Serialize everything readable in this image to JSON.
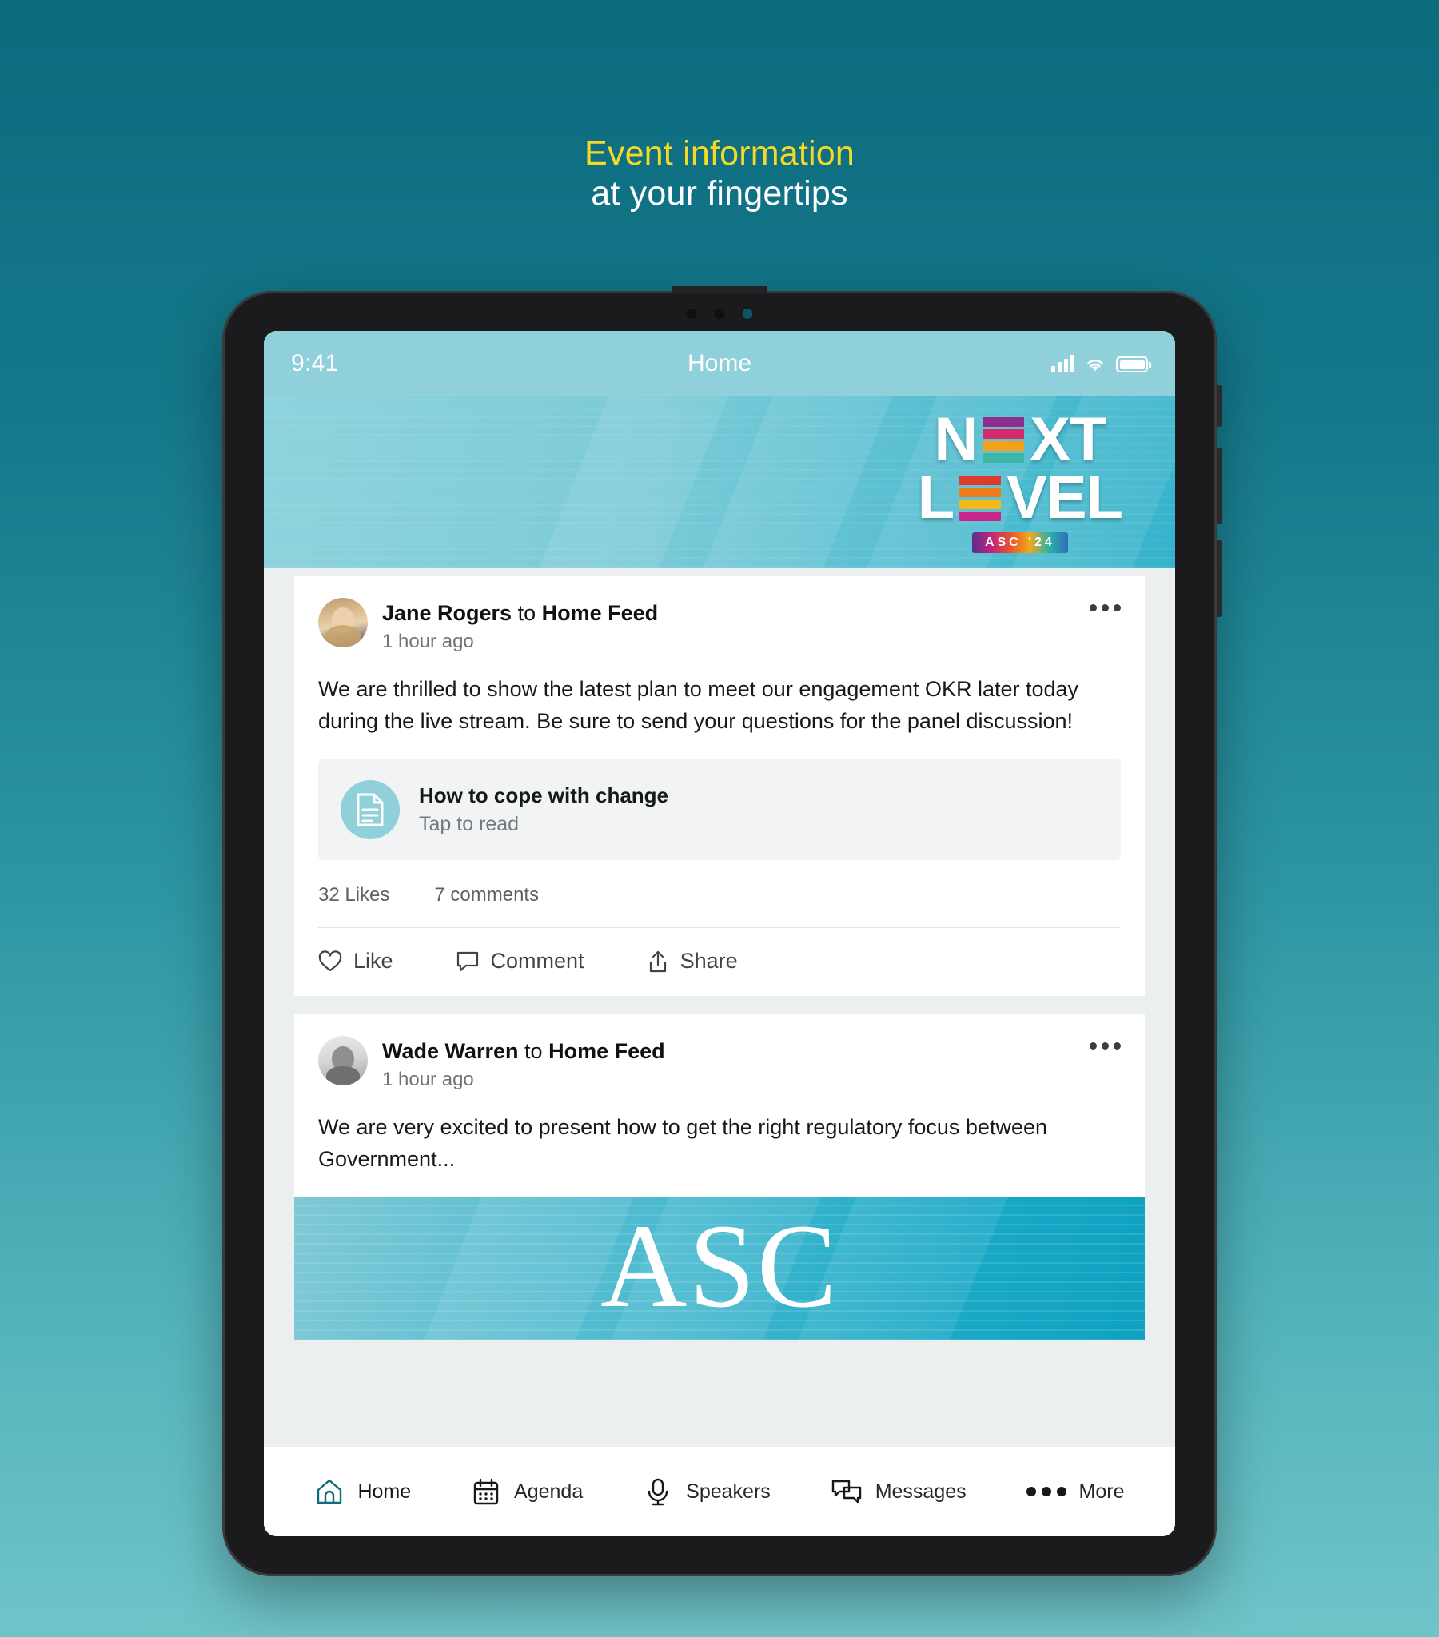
{
  "promo": {
    "line1": "Event information",
    "line2": "at your fingertips",
    "accent_color": "#f5d927"
  },
  "status_bar": {
    "time": "9:41",
    "title": "Home",
    "signal_icon": "cellular-signal-icon",
    "wifi_icon": "wifi-icon",
    "battery_icon": "battery-full-icon"
  },
  "hero": {
    "logo_line1": "NEXT",
    "logo_line2": "LEVEL",
    "logo_sub": "ASC '24"
  },
  "posts": [
    {
      "author": "Jane Rogers",
      "to_word": "to",
      "channel": "Home Feed",
      "time": "1 hour ago",
      "body": "We are thrilled to show the latest plan to meet our engagement OKR later today during the live stream. Be sure to send your questions for the panel discussion!",
      "attachment": {
        "title": "How to cope with change",
        "subtitle": "Tap to read",
        "icon": "document-icon"
      },
      "likes": "32 Likes",
      "comments": "7 comments",
      "actions": [
        {
          "label": "Like",
          "icon": "heart-icon"
        },
        {
          "label": "Comment",
          "icon": "comment-bubble-icon"
        },
        {
          "label": "Share",
          "icon": "share-icon"
        }
      ]
    },
    {
      "author": "Wade Warren",
      "to_word": "to",
      "channel": "Home Feed",
      "time": "1 hour ago",
      "body": "We are very excited to present how to get the right regulatory focus between Government...",
      "image_text": "ASC"
    }
  ],
  "tabbar": {
    "items": [
      {
        "label": "Home",
        "icon": "home-icon",
        "active": true
      },
      {
        "label": "Agenda",
        "icon": "calendar-icon",
        "active": false
      },
      {
        "label": "Speakers",
        "icon": "microphone-icon",
        "active": false
      },
      {
        "label": "Messages",
        "icon": "chat-bubbles-icon",
        "active": false
      },
      {
        "label": "More",
        "icon": "ellipsis-icon",
        "active": false
      }
    ]
  }
}
